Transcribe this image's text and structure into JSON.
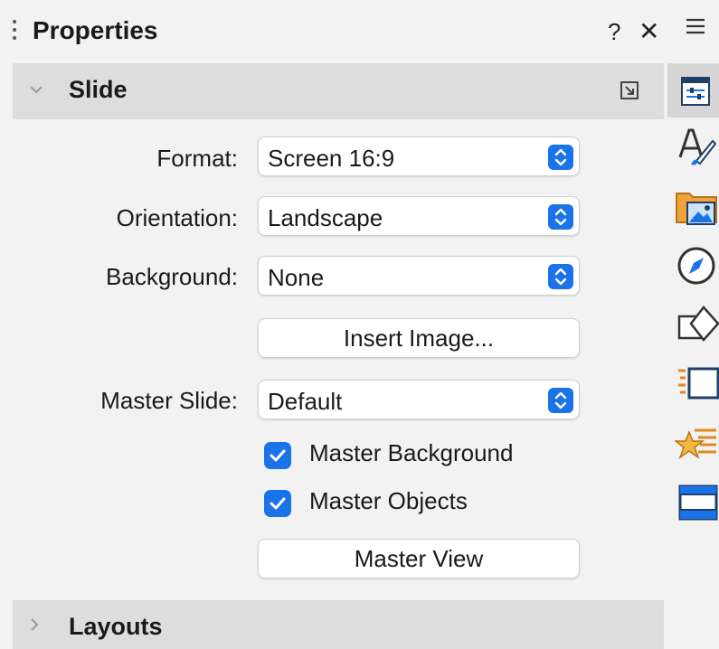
{
  "title": "Properties",
  "title_buttons": {
    "help": "?",
    "close": "✕"
  },
  "sections": {
    "slide": {
      "label": "Slide",
      "expanded": true
    },
    "layouts": {
      "label": "Layouts",
      "expanded": false
    }
  },
  "slide": {
    "format": {
      "label": "Format:",
      "value": "Screen 16:9"
    },
    "orientation": {
      "label": "Orientation:",
      "value": "Landscape"
    },
    "background": {
      "label": "Background:",
      "value": "None"
    },
    "insert_image": "Insert Image...",
    "master_slide": {
      "label": "Master Slide:",
      "value": "Default"
    },
    "master_background": {
      "label": "Master Background",
      "checked": true
    },
    "master_objects": {
      "label": "Master Objects",
      "checked": true
    },
    "master_view": "Master View"
  },
  "tabbar": {
    "menu_icon": "hamburger-menu-icon",
    "tabs": [
      {
        "icon": "properties-icon",
        "active": true
      },
      {
        "icon": "styles-icon",
        "active": false
      },
      {
        "icon": "gallery-icon",
        "active": false
      },
      {
        "icon": "navigator-icon",
        "active": false
      },
      {
        "icon": "shapes-icon",
        "active": false
      },
      {
        "icon": "slide-transition-icon",
        "active": false
      },
      {
        "icon": "animation-icon",
        "active": false
      },
      {
        "icon": "master-slides-icon",
        "active": false
      }
    ]
  },
  "colors": {
    "accent": "#1a73e8",
    "header_bg": "#dddddd",
    "panel_bg": "#f2f2f2"
  }
}
